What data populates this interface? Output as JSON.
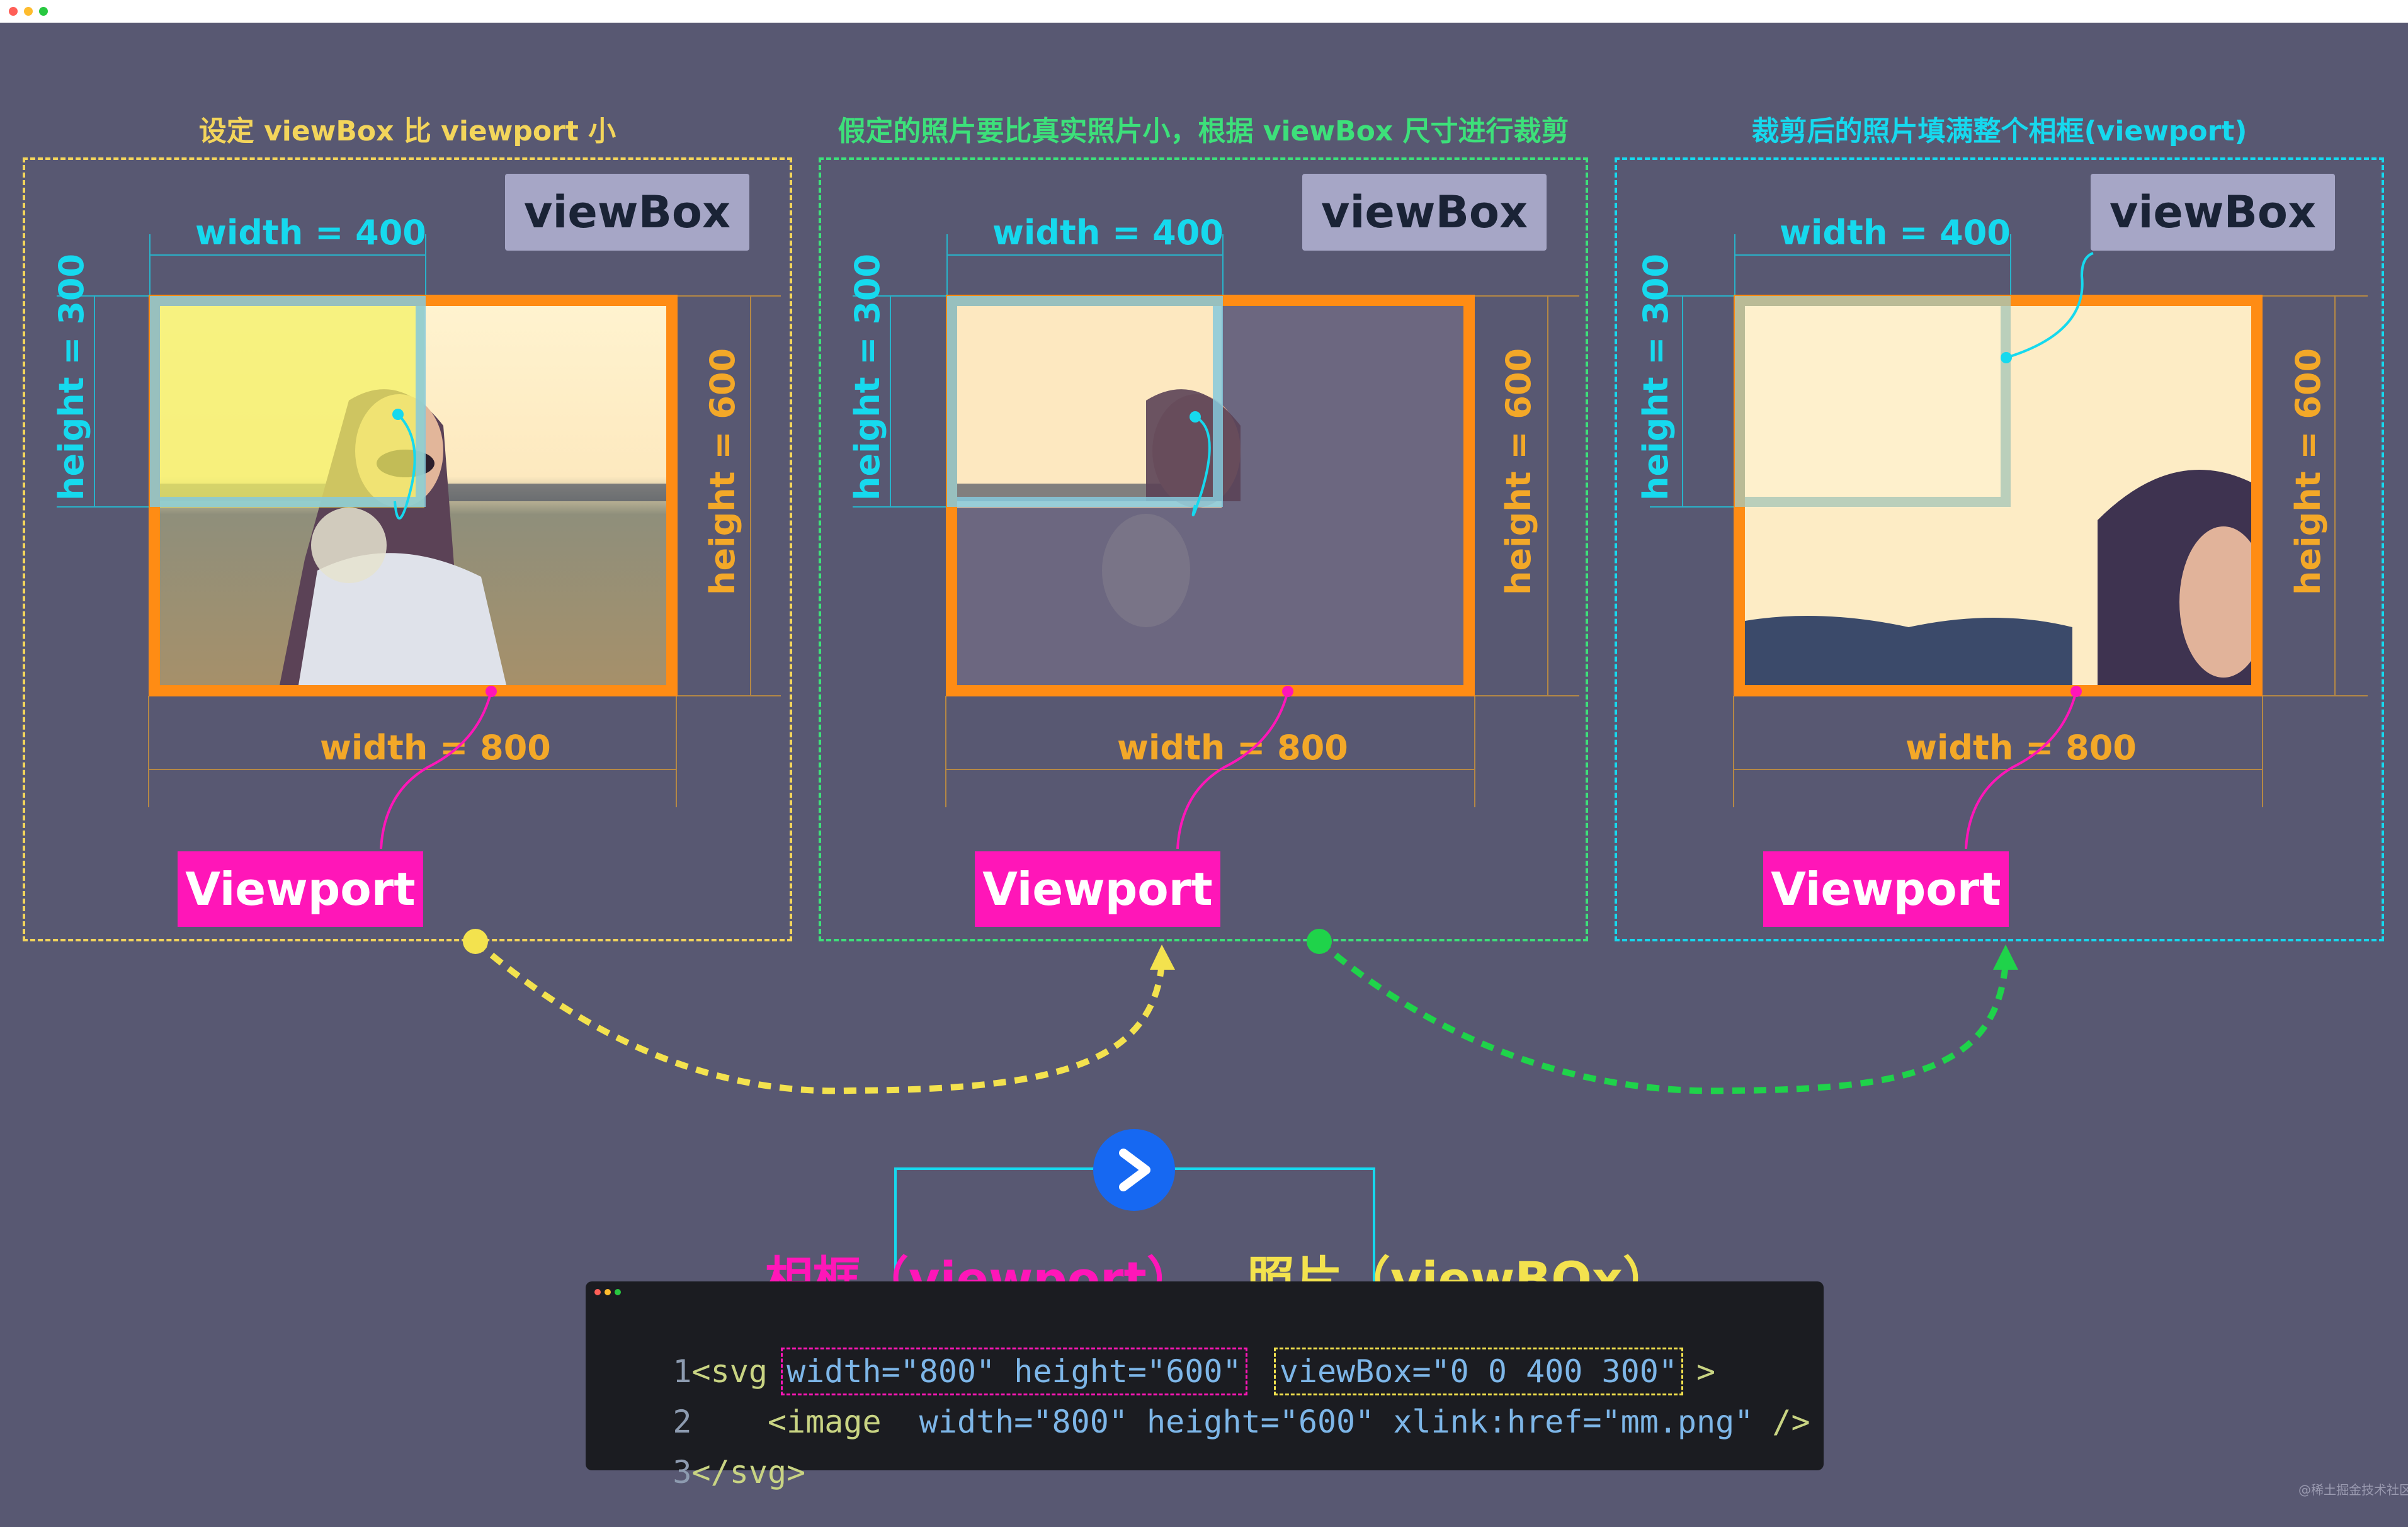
{
  "panels": [
    {
      "title": "设定 viewBox 比 viewport 小",
      "title_color": "#f3d55b",
      "border_color": "#f3d55b",
      "viewbox_tag": "viewBox",
      "viewport_tag": "Viewport",
      "width_vb": "width = 400",
      "height_vb": "height = 300",
      "width_vp": "width = 800",
      "height_vp": "height = 600"
    },
    {
      "title": "假定的照片要比真实照片小，根据 viewBox 尺寸进行裁剪",
      "title_color": "#3de07a",
      "border_color": "#3de07a",
      "viewbox_tag": "viewBox",
      "viewport_tag": "Viewport",
      "width_vb": "width = 400",
      "height_vb": "height = 300",
      "width_vp": "width = 800",
      "height_vp": "height = 600"
    },
    {
      "title": "裁剪后的照片填满整个相框(viewport)",
      "title_color": "#16d9ee",
      "border_color": "#16d9ee",
      "viewbox_tag": "viewBox",
      "viewport_tag": "Viewport",
      "width_vb": "width = 400",
      "height_vb": "height = 300",
      "width_vp": "width = 800",
      "height_vp": "height = 600"
    }
  ],
  "labels": {
    "frame_label": "相框（viewport）",
    "photo_label": "照片（viewBOx）"
  },
  "code": {
    "l1_num": "1",
    "l1_open": "<svg",
    "l1_attr1": "width=\"800\" height=\"600\"",
    "l1_attr2": "viewBox=\"0 0 400 300\"",
    "l1_close": ">",
    "l2_num": "2",
    "l2_tag": "<image",
    "l2_attrs": "width=\"800\" height=\"600\" xlink:href=\"mm.png\"",
    "l2_close": "/>",
    "l3_num": "3",
    "l3_close": "</svg>"
  },
  "watermark": "@稀土掘金技术社区",
  "colors": {
    "background": "#585872",
    "viewport_border": "#ff8c14",
    "viewport_tag": "#ff16b8",
    "viewbox_tag": "#a6a6c6",
    "cyan_label": "#16d9ee",
    "orange_label": "#f3a828",
    "yellow_arrow": "#f3e24e",
    "green_arrow": "#1fd34a",
    "play_button": "#1668f2"
  }
}
